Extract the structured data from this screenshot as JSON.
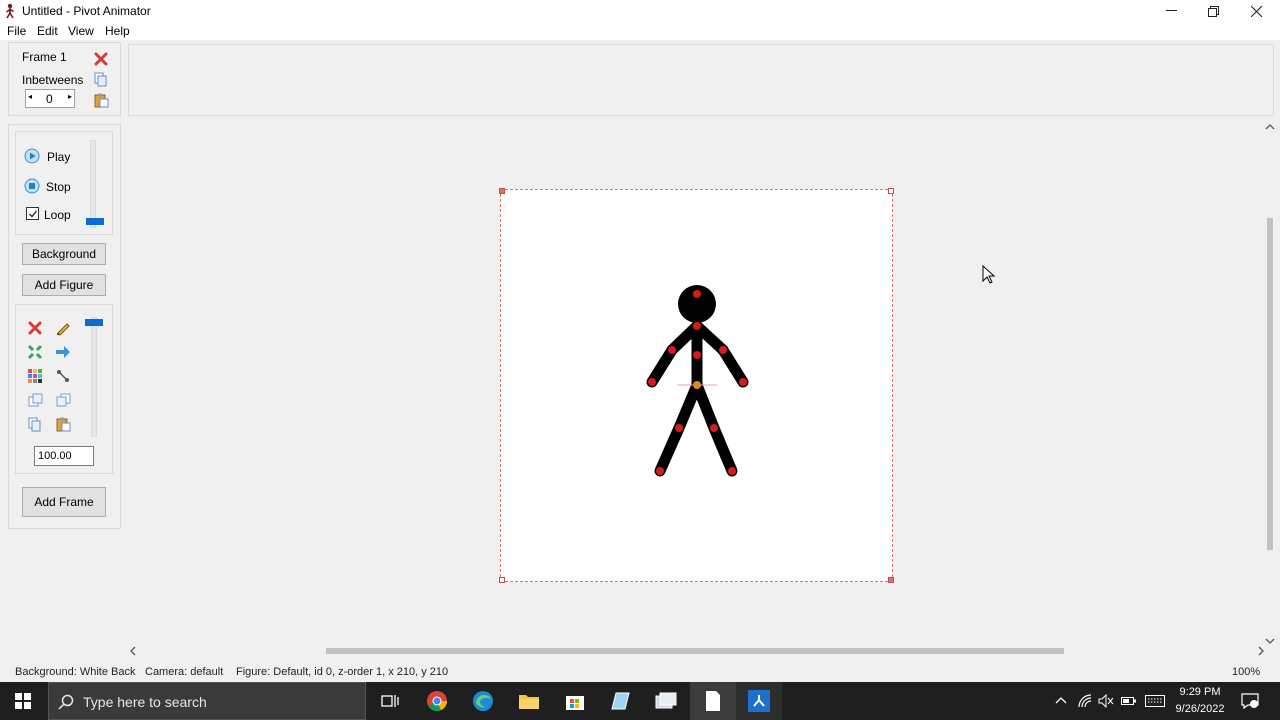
{
  "window": {
    "title": "Untitled - Pivot Animator"
  },
  "menu": [
    "File",
    "Edit",
    "View",
    "Help"
  ],
  "frame_panel": {
    "frame_label": "Frame 1",
    "inbetweens_label": "Inbetweens",
    "inbetweens_value": "0"
  },
  "playback": {
    "play_label": "Play",
    "stop_label": "Stop",
    "loop_label": "Loop",
    "loop_checked": true
  },
  "buttons": {
    "background": "Background",
    "add_figure": "Add Figure",
    "add_frame": "Add Frame"
  },
  "figure_tools": {
    "scale_value": "100.00",
    "icons": [
      "delete-icon",
      "edit-pencil-icon",
      "center-icon",
      "flip-icon",
      "color-icon",
      "join-icon",
      "duplicate-icon",
      "split-icon",
      "copy-icon",
      "paste-icon"
    ]
  },
  "status": {
    "background": "Background: White Back",
    "camera": "Camera: default",
    "figure": "Figure: Default,  id 0,  z-order 1,  x 210, y 210",
    "zoom": "100%"
  },
  "taskbar": {
    "search_placeholder": "Type here to search",
    "time": "9:29 PM",
    "date": "9/26/2022"
  },
  "colors": {
    "accent": "#0a6cd4",
    "joint": "#d71920",
    "center_joint": "#e08a1e",
    "figure": "#000000",
    "canvas_border": "#e07070"
  }
}
